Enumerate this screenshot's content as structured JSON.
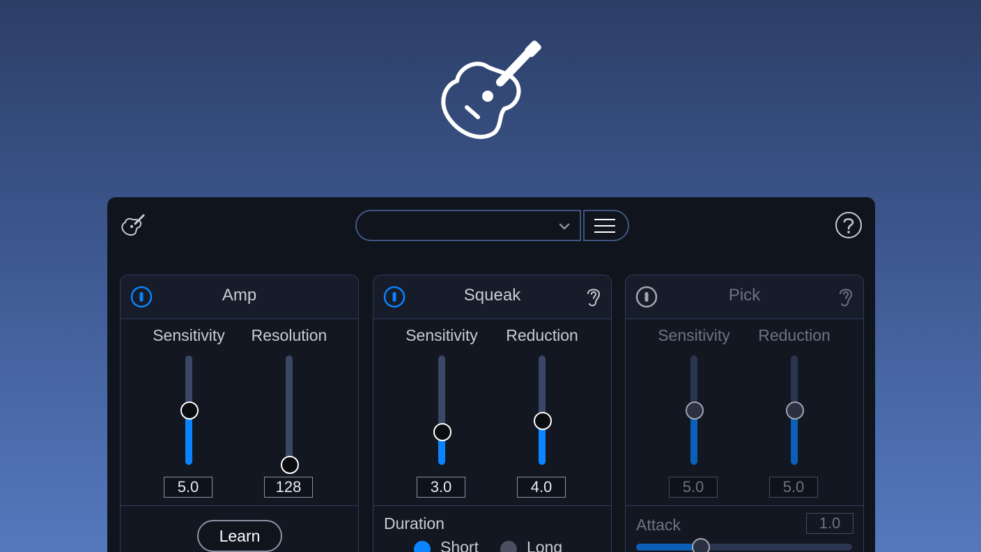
{
  "colors": {
    "accent": "#0a84ff",
    "panel": "#10141d",
    "border": "#2f3d5c",
    "text": "#c7ccd6",
    "disabled_text": "#6c7383"
  },
  "icons": {
    "hero": "acoustic-guitar-icon",
    "logo": "acoustic-guitar-icon",
    "help": "help-circle-icon",
    "menu": "hamburger-menu-icon",
    "dropdown": "chevron-down-icon",
    "power": "power-icon",
    "listen": "ear-icon"
  },
  "header": {
    "preset": {
      "value": ""
    }
  },
  "modules": {
    "amp": {
      "title": "Amp",
      "enabled": true,
      "sensitivity": {
        "label": "Sensitivity",
        "value": "5.0",
        "level": 0.5
      },
      "resolution": {
        "label": "Resolution",
        "value": "128",
        "level": 0.0
      },
      "learn_label": "Learn"
    },
    "squeak": {
      "title": "Squeak",
      "enabled": true,
      "sensitivity": {
        "label": "Sensitivity",
        "value": "3.0",
        "level": 0.3
      },
      "reduction": {
        "label": "Reduction",
        "value": "4.0",
        "level": 0.4
      },
      "duration": {
        "label": "Duration",
        "options": [
          "Short",
          "Long"
        ],
        "selected": "Short"
      }
    },
    "pick": {
      "title": "Pick",
      "enabled": false,
      "sensitivity": {
        "label": "Sensitivity",
        "value": "5.0",
        "level": 0.5
      },
      "reduction": {
        "label": "Reduction",
        "value": "5.0",
        "level": 0.5
      },
      "attack": {
        "label": "Attack",
        "value": "1.0",
        "level": 0.3
      }
    }
  }
}
